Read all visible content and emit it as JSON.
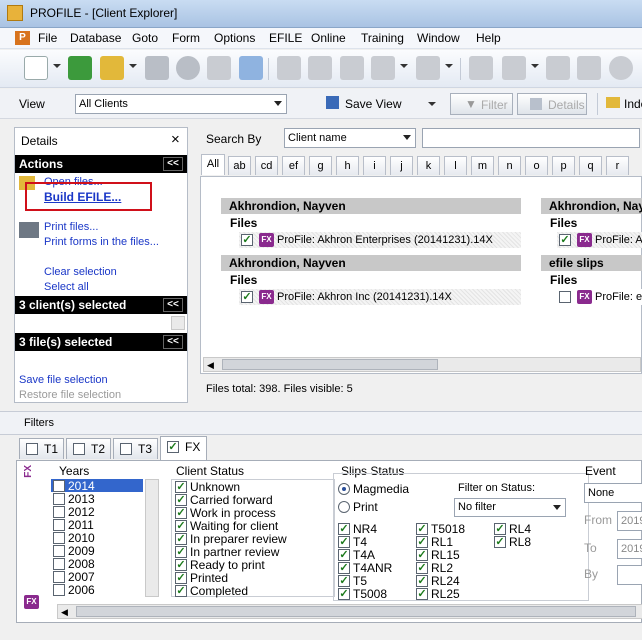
{
  "window": {
    "title": "PROFILE - [Client Explorer]"
  },
  "menu": [
    "File",
    "Database",
    "Goto",
    "Form",
    "Options",
    "EFILE",
    "Online",
    "Training",
    "Window",
    "Help"
  ],
  "viewbar": {
    "view_label": "View",
    "view_value": "All Clients",
    "save_view": "Save View",
    "filter": "Filter",
    "details": "Details",
    "index": "Inde"
  },
  "leftpanel": {
    "title": "Details",
    "close": "×",
    "actions_header": "Actions",
    "chev": "<<",
    "open_files": "Open files...",
    "build_efile": "Build EFILE...",
    "print_files": "Print files...",
    "print_forms": "Print forms in the files...",
    "clear_selection": "Clear selection",
    "select_all": "Select all",
    "clients_selected": "3 client(s) selected",
    "files_selected": "3 file(s) selected",
    "save_file_selection": "Save file selection",
    "restore_file_selection": "Restore file selection"
  },
  "search": {
    "label": "Search By",
    "field": "Client name",
    "value": ""
  },
  "letters": [
    "All",
    "ab",
    "cd",
    "ef",
    "g",
    "h",
    "i",
    "j",
    "k",
    "l",
    "m",
    "n",
    "o",
    "p",
    "q",
    "r"
  ],
  "results": {
    "files_label": "Files",
    "clients": [
      {
        "name": "Akhrondion, Nayven",
        "file": "ProFile: Akhron Enterprises (20141231).14X",
        "checked": true
      },
      {
        "name": "Akhrondion, Nayven",
        "file": "ProFile: Akhron Inc (20141231).14X",
        "checked": true
      },
      {
        "name": "Akhrondion, Nayv",
        "file": "ProFile: Al",
        "checked": true
      },
      {
        "name": "efile slips",
        "file": "ProFile: ef",
        "checked": false
      }
    ],
    "status": "Files total: 398. Files visible: 5"
  },
  "filters": {
    "title": "Filters",
    "tabs": [
      "T1",
      "T2",
      "T3",
      "FX"
    ],
    "fx_label": "FX",
    "years_label": "Years",
    "years": [
      "2014",
      "2013",
      "2012",
      "2011",
      "2010",
      "2009",
      "2008",
      "2007",
      "2006"
    ],
    "client_status_label": "Client Status",
    "client_status": [
      "Unknown",
      "Carried forward",
      "Work in process",
      "Waiting for client",
      "In preparer review",
      "In partner review",
      "Ready to print",
      "Printed",
      "Completed"
    ],
    "slips_status_label": "Slips Status",
    "slips_magmedia": "Magmedia",
    "slips_print": "Print",
    "filter_on_status_label": "Filter on Status:",
    "filter_on_status_value": "No filter",
    "slips_col1": [
      "NR4",
      "T4",
      "T4A",
      "T4ANR",
      "T5",
      "T5008"
    ],
    "slips_col2": [
      "T5018",
      "RL1",
      "RL15",
      "RL2",
      "RL24",
      "RL25"
    ],
    "slips_col3": [
      "RL4",
      "RL8"
    ],
    "event_label": "Event",
    "event_value": "None",
    "from_label": "From",
    "from_value": "2019",
    "to_label": "To",
    "to_value": "2019",
    "by_label": "By"
  }
}
